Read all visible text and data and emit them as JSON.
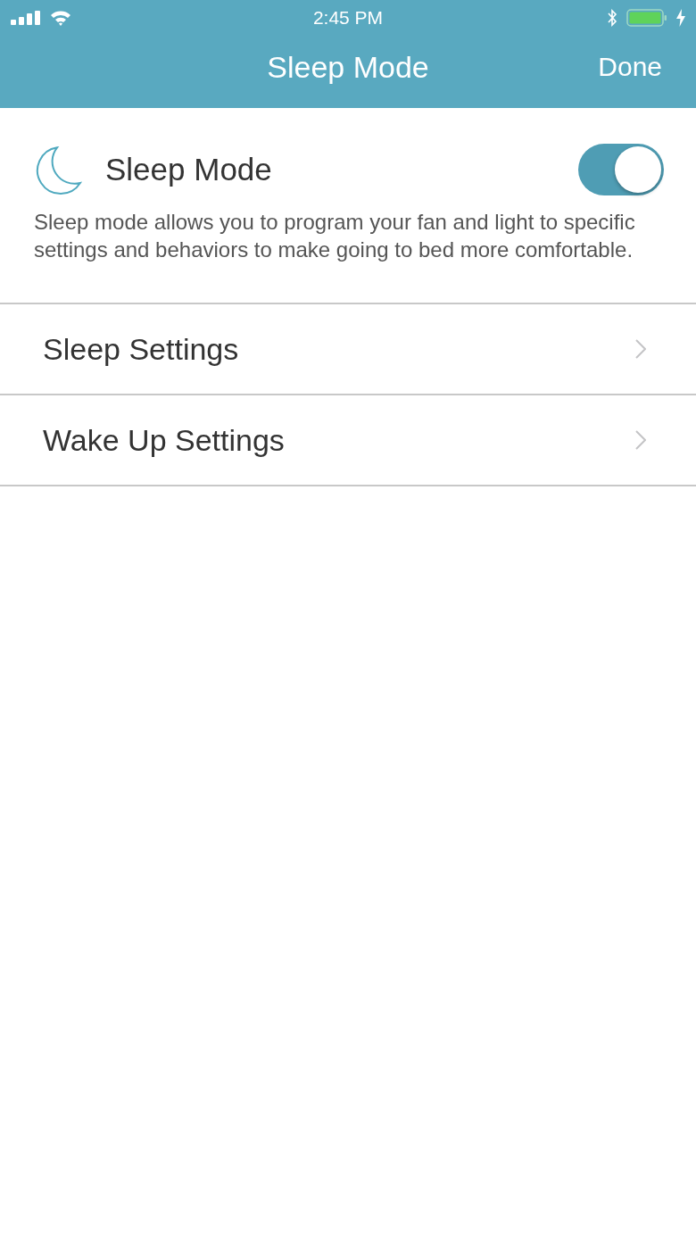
{
  "status_bar": {
    "time": "2:45 PM"
  },
  "nav_bar": {
    "title": "Sleep Mode",
    "done": "Done"
  },
  "sleep_mode": {
    "label": "Sleep Mode",
    "on": true,
    "description": "Sleep mode allows you to program your fan and light to specific settings and behaviors to make going to bed more comfortable."
  },
  "settings": [
    {
      "label": "Sleep Settings"
    },
    {
      "label": "Wake Up Settings"
    }
  ]
}
